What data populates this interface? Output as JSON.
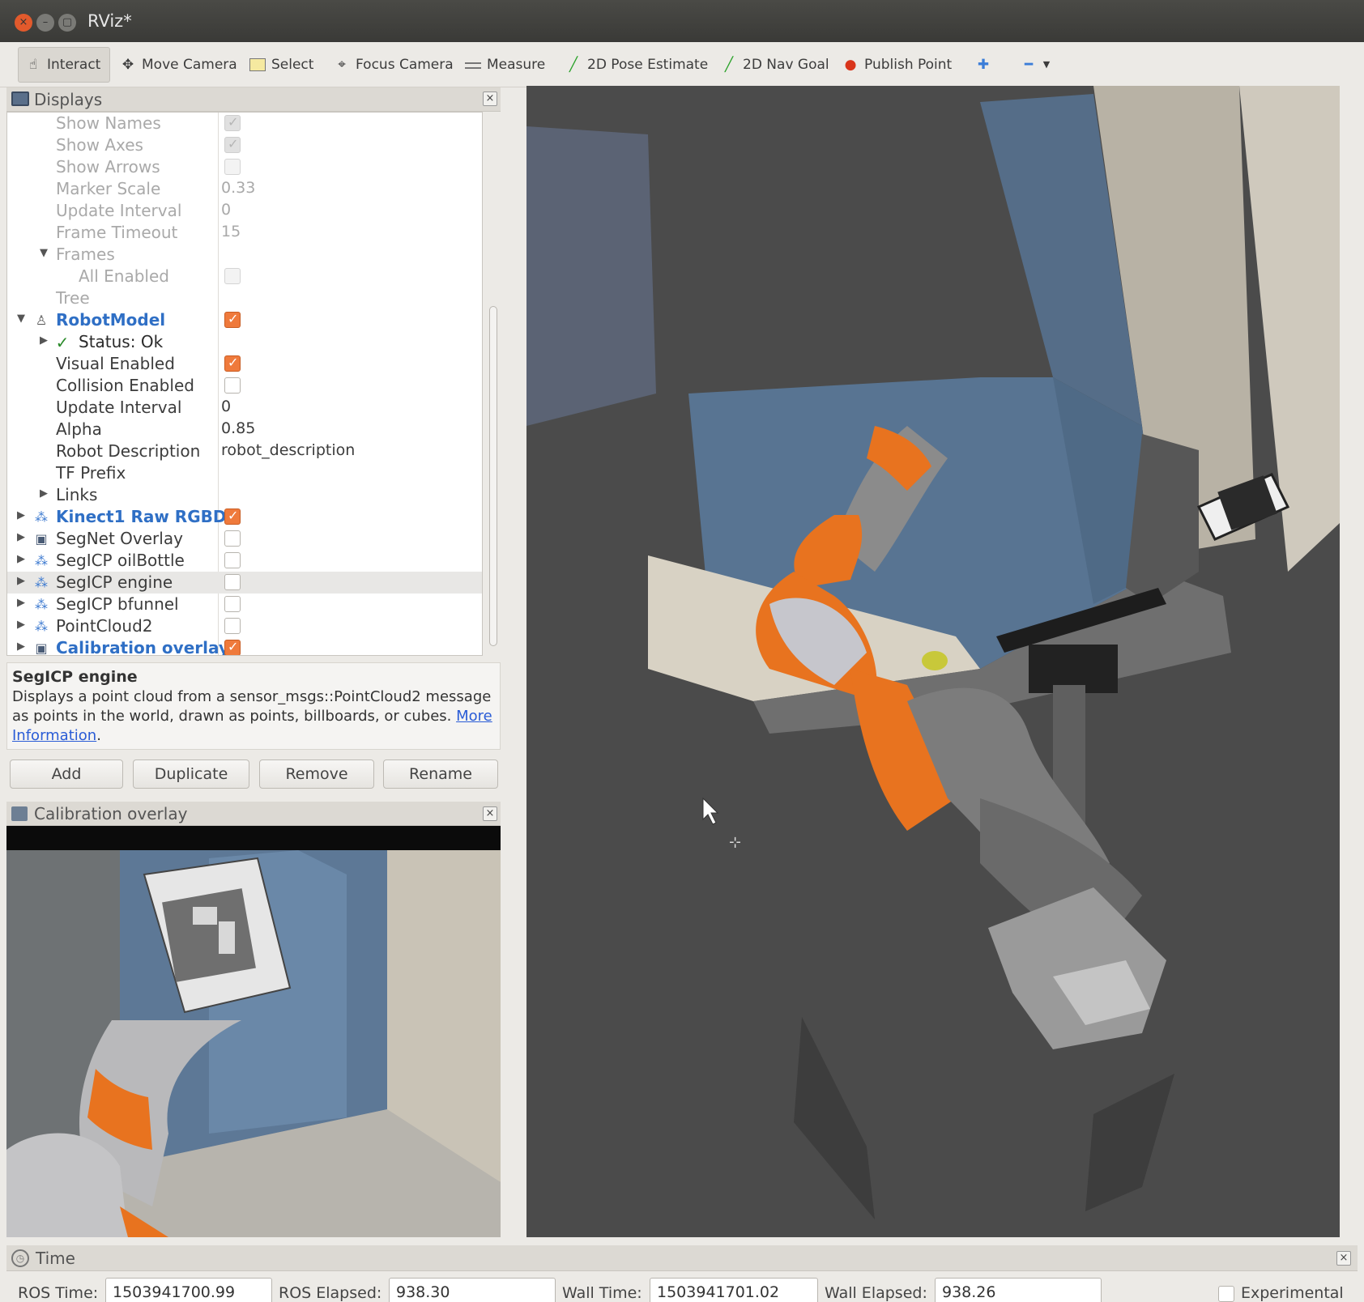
{
  "window": {
    "title": "RViz*"
  },
  "toolbar": {
    "interact": "Interact",
    "move_camera": "Move Camera",
    "select": "Select",
    "focus_camera": "Focus Camera",
    "measure": "Measure",
    "pose_estimate": "2D Pose Estimate",
    "nav_goal": "2D Nav Goal",
    "publish_point": "Publish Point"
  },
  "displays": {
    "title": "Displays",
    "rows": [
      {
        "name": "Show Names",
        "checked": true,
        "disabled": true
      },
      {
        "name": "Show Axes",
        "checked": true,
        "disabled": true
      },
      {
        "name": "Show Arrows",
        "checked": false,
        "disabled": true
      },
      {
        "name": "Marker Scale",
        "value": "0.33"
      },
      {
        "name": "Update Interval",
        "value": "0"
      },
      {
        "name": "Frame Timeout",
        "value": "15"
      },
      {
        "name": "Frames"
      },
      {
        "name": "All Enabled",
        "checked": false,
        "disabled": true
      },
      {
        "name": "Tree"
      },
      {
        "name": "RobotModel",
        "checked": true
      },
      {
        "name": "Status: Ok"
      },
      {
        "name": "Visual Enabled",
        "checked": true
      },
      {
        "name": "Collision Enabled",
        "checked": false
      },
      {
        "name": "Update Interval",
        "value": "0"
      },
      {
        "name": "Alpha",
        "value": "0.85"
      },
      {
        "name": "Robot Description",
        "value": "robot_description"
      },
      {
        "name": "TF Prefix"
      },
      {
        "name": "Links"
      },
      {
        "name": "Kinect1 Raw RGBD",
        "checked": true
      },
      {
        "name": "SegNet Overlay",
        "checked": false
      },
      {
        "name": "SegICP oilBottle",
        "checked": false
      },
      {
        "name": "SegICP engine",
        "checked": false
      },
      {
        "name": "SegICP bfunnel",
        "checked": false
      },
      {
        "name": "PointCloud2",
        "checked": false
      },
      {
        "name": "Calibration overlay",
        "checked": true
      }
    ]
  },
  "description": {
    "title": "SegICP engine",
    "text": "Displays a point cloud from a sensor_msgs::PointCloud2 message as points in the world, drawn as points, billboards, or cubes.",
    "link": "More Information",
    "after_link": "."
  },
  "buttons": {
    "add": "Add",
    "duplicate": "Duplicate",
    "remove": "Remove",
    "rename": "Rename"
  },
  "calibration": {
    "title": "Calibration overlay"
  },
  "time": {
    "title": "Time",
    "ros_time_label": "ROS Time:",
    "ros_time": "1503941700.99",
    "ros_elapsed_label": "ROS Elapsed:",
    "ros_elapsed": "938.30",
    "wall_time_label": "Wall Time:",
    "wall_time": "1503941701.02",
    "wall_elapsed_label": "Wall Elapsed:",
    "wall_elapsed": "938.26",
    "experimental_label": "Experimental"
  },
  "colors": {
    "accent": "#ef7a3c",
    "link_blue": "#2f6fc5",
    "robot_orange": "#e8731f",
    "view_background": "#4b4b4b"
  }
}
